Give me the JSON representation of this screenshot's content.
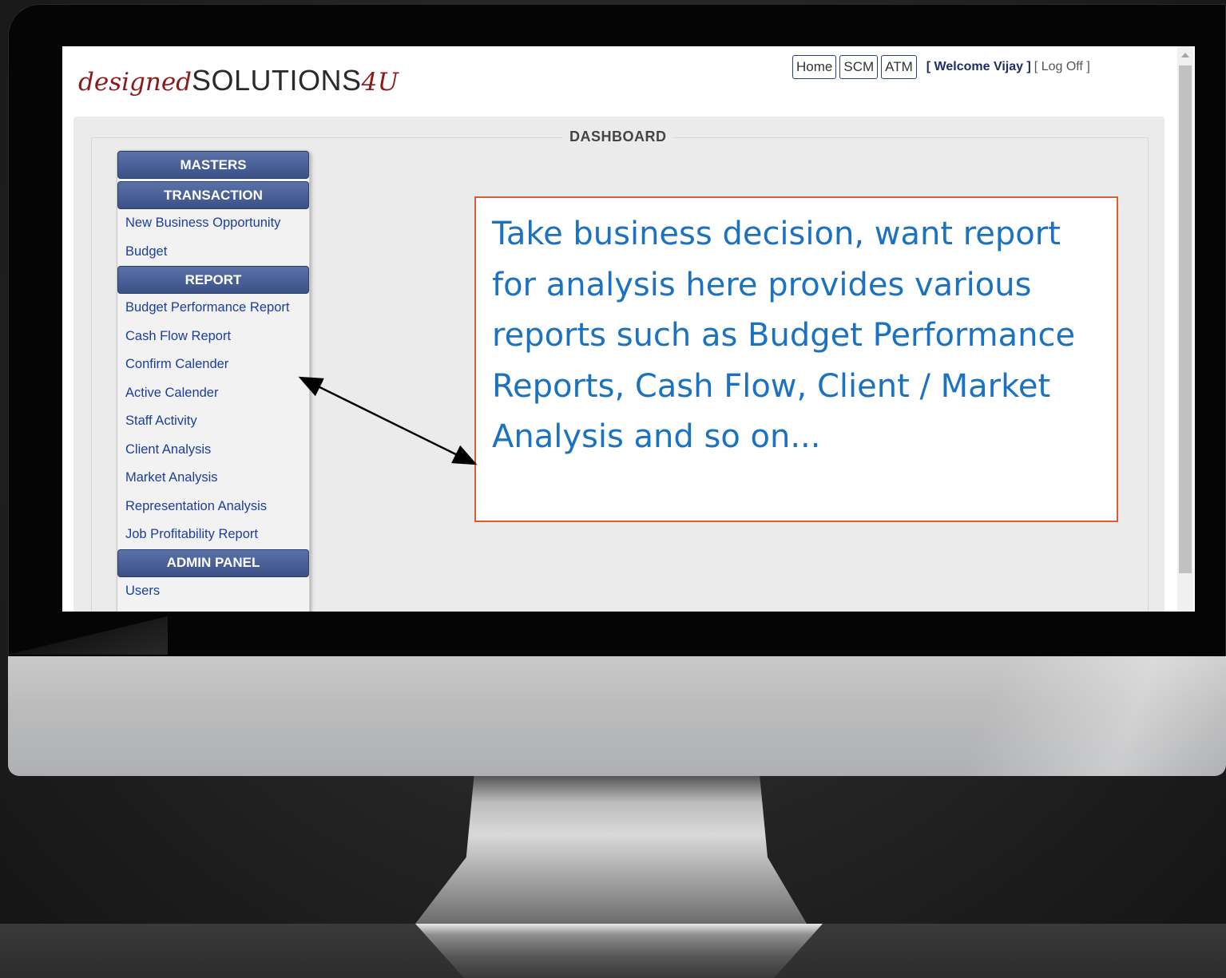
{
  "app": {
    "logo_prefix": "designed",
    "logo_main": "SOLUTIONS",
    "logo_suffix": "4U"
  },
  "topnav": {
    "buttons": [
      "Home",
      "SCM",
      "ATM"
    ],
    "welcome": "[ Welcome Vijay ]",
    "logoff_open": "[",
    "logoff_label": "Log Off",
    "logoff_close": "]"
  },
  "dashboard": {
    "title": "DASHBOARD"
  },
  "sidebar": {
    "sections": [
      {
        "label": "MASTERS",
        "items": []
      },
      {
        "label": "TRANSACTION",
        "items": [
          "New Business Opportunity",
          "Budget"
        ]
      },
      {
        "label": "REPORT",
        "items": [
          "Budget Performance Report",
          "Cash Flow Report",
          "Confirm Calender",
          "Active Calender",
          "Staff Activity",
          "Client Analysis",
          "Market Analysis",
          "Representation Analysis",
          "Job Profitability Report"
        ]
      },
      {
        "label": "ADMIN PANEL",
        "items": [
          "Users"
        ]
      }
    ]
  },
  "annotation": {
    "text": "Take business decision, want report for analysis here provides various reports such as Budget Performance Reports, Cash Flow, Client / Market Analysis and so on...",
    "border_color": "#e25a2a",
    "text_color": "#1a72c0"
  },
  "colors": {
    "section_header": "#3b5186",
    "link": "#1c3f9e"
  }
}
